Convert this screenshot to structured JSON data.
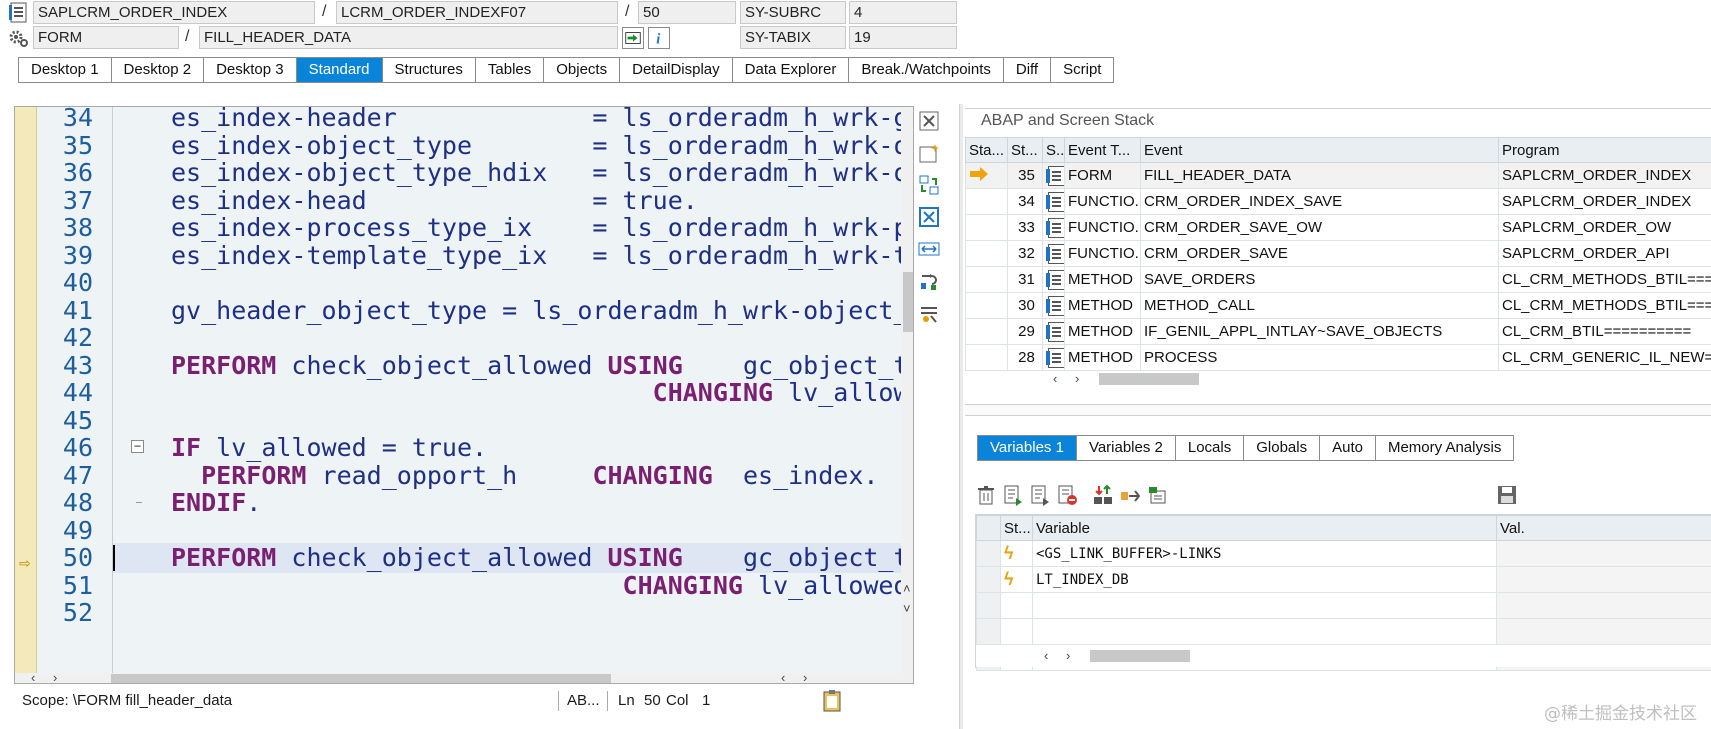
{
  "header": {
    "row1": {
      "program": "SAPLCRM_ORDER_INDEX",
      "include": "LCRM_ORDER_INDEXF07",
      "line": "50",
      "sysvar_name": "SY-SUBRC",
      "sysvar_value": "4"
    },
    "row2": {
      "event_type": "FORM",
      "event_name": "FILL_HEADER_DATA",
      "sysvar_name": "SY-TABIX",
      "sysvar_value": "19"
    },
    "separator": "/"
  },
  "main_tabs": [
    "Desktop 1",
    "Desktop 2",
    "Desktop 3",
    "Standard",
    "Structures",
    "Tables",
    "Objects",
    "DetailDisplay",
    "Data Explorer",
    "Break./Watchpoints",
    "Diff",
    "Script"
  ],
  "active_main_tab": "Standard",
  "editor": {
    "lines": [
      {
        "num": "34",
        "text": "es_index-header             = ls_orderadm_h_wrk-guid."
      },
      {
        "num": "35",
        "text": "es_index-object_type        = ls_orderadm_h_wrk-object_type."
      },
      {
        "num": "36",
        "text": "es_index-object_type_hdix   = ls_orderadm_h_wrk-object_type."
      },
      {
        "num": "37",
        "text": "es_index-head               = true."
      },
      {
        "num": "38",
        "text": "es_index-process_type_ix    = ls_orderadm_h_wrk-process_type."
      },
      {
        "num": "39",
        "text": "es_index-template_type_ix   = ls_orderadm_h_wrk-template_type."
      },
      {
        "num": "40",
        "text": ""
      },
      {
        "num": "41",
        "text": "gv_header_object_type = ls_orderadm_h_wrk-object_type."
      },
      {
        "num": "42",
        "text": ""
      },
      {
        "num": "43",
        "kw": "PERFORM",
        "text": " check_object_allowed ",
        "kw2": "USING",
        "tail": "    gc_object_type"
      },
      {
        "num": "44",
        "indent": "                                ",
        "kw": "CHANGING",
        "tail": " lv_allowed."
      },
      {
        "num": "45",
        "text": ""
      },
      {
        "num": "46",
        "kw": "IF",
        "text": " lv_allowed = true."
      },
      {
        "num": "47",
        "indent": "  ",
        "kw": "PERFORM",
        "text": " read_opport_h     ",
        "kw2": "CHANGING",
        "tail": "  es_index."
      },
      {
        "num": "48",
        "kw": "ENDIF",
        "text": "."
      },
      {
        "num": "49",
        "text": ""
      },
      {
        "num": "50",
        "kw": "PERFORM",
        "text": " check_object_allowed ",
        "kw2": "USING",
        "tail": "    gc_object_type"
      },
      {
        "num": "51",
        "indent": "                              ",
        "kw": "CHANGING",
        "tail": " lv_allowed."
      },
      {
        "num": "52",
        "text": ""
      }
    ],
    "current_line": "50"
  },
  "statusbar": {
    "scope": "Scope: \\FORM fill_header_data",
    "lang": "AB...",
    "ln_label": "Ln",
    "ln_value": "50",
    "col_label": "Col",
    "col_value": "1"
  },
  "stack": {
    "title": "ABAP and Screen Stack",
    "columns": [
      "Sta...",
      "St...",
      "S..",
      "Event T...",
      "Event",
      "Program"
    ],
    "rows": [
      {
        "active": true,
        "level": "35",
        "event_type": "FORM",
        "event": "FILL_HEADER_DATA",
        "program": "SAPLCRM_ORDER_INDEX"
      },
      {
        "active": false,
        "level": "34",
        "event_type": "FUNCTIO...",
        "event": "CRM_ORDER_INDEX_SAVE",
        "program": "SAPLCRM_ORDER_INDEX"
      },
      {
        "active": false,
        "level": "33",
        "event_type": "FUNCTIO...",
        "event": "CRM_ORDER_SAVE_OW",
        "program": "SAPLCRM_ORDER_OW"
      },
      {
        "active": false,
        "level": "32",
        "event_type": "FUNCTIO...",
        "event": "CRM_ORDER_SAVE",
        "program": "SAPLCRM_ORDER_API"
      },
      {
        "active": false,
        "level": "31",
        "event_type": "METHOD",
        "event": "SAVE_ORDERS",
        "program": "CL_CRM_METHODS_BTIL==="
      },
      {
        "active": false,
        "level": "30",
        "event_type": "METHOD",
        "event": "METHOD_CALL",
        "program": "CL_CRM_METHODS_BTIL==="
      },
      {
        "active": false,
        "level": "29",
        "event_type": "METHOD",
        "event": "IF_GENIL_APPL_INTLAY~SAVE_OBJECTS",
        "program": "CL_CRM_BTIL=========="
      },
      {
        "active": false,
        "level": "28",
        "event_type": "METHOD",
        "event": "PROCESS",
        "program": "CL_CRM_GENERIC_IL_NEW="
      }
    ]
  },
  "var_tabs": [
    "Variables 1",
    "Variables 2",
    "Locals",
    "Globals",
    "Auto",
    "Memory Analysis"
  ],
  "active_var_tab": "Variables 1",
  "variables": {
    "columns": [
      "St...",
      "Variable",
      "Val."
    ],
    "rows": [
      {
        "name": "<GS_LINK_BUFFER>-LINKS",
        "value": ""
      },
      {
        "name": "LT_INDEX_DB",
        "value": ""
      },
      {
        "name": "",
        "value": ""
      },
      {
        "name": "",
        "value": ""
      },
      {
        "name": "",
        "value": ""
      }
    ]
  },
  "watermark": "@稀土掘金技术社区",
  "colors": {
    "active_tab": "#0a84d8",
    "keyword": "#7a1f72",
    "code_text": "#1f2f86",
    "line_number": "#1e5e9e",
    "current_line_bg": "#dde6f2",
    "marker_gutter": "#f4e9b8",
    "stack_arrow": "#f0a30a"
  }
}
